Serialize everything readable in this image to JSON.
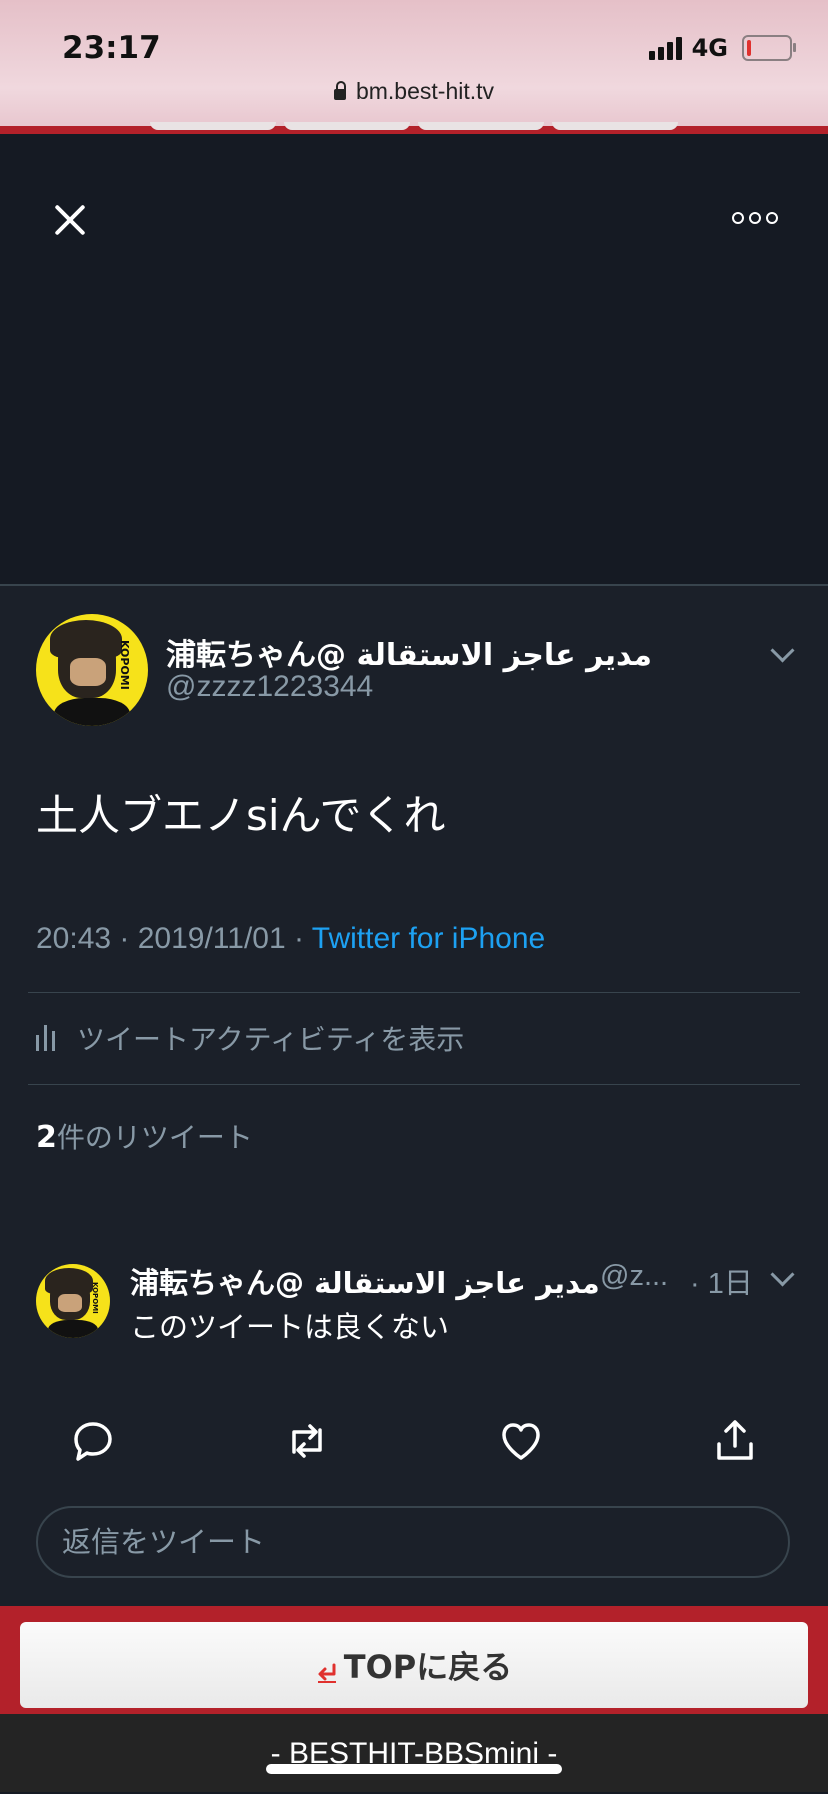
{
  "status_bar": {
    "time": "23:17",
    "network": "4G"
  },
  "browser": {
    "url": "bm.best-hit.tv"
  },
  "tweet": {
    "author_name": "浦転ちゃん@ مدير عاجز الاستقالة",
    "author_handle": "@zzzz1223344",
    "text": "土人ブエノsiんでくれ",
    "timestamp": "20:43 · 2019/11/01 · ",
    "source": "Twitter for iPhone",
    "activity_label": "ツイートアクティビティを表示",
    "retweet_count": "2",
    "retweet_label": "件のリツイート"
  },
  "reply": {
    "author_name": "浦転ちゃん@ مدير عاجز الاستقالة",
    "author_handle": "@z...",
    "time": "· 1日",
    "text": "このツイートは良くない"
  },
  "reply_input": {
    "placeholder": "返信をツイート"
  },
  "page": {
    "top_button_label": "TOPに戻る",
    "footer_prefix": "- ",
    "footer_link": "BESTHIT-BBSmini",
    "footer_suffix": " -"
  },
  "icons": {
    "close": "close-icon",
    "more": "more-icon",
    "chevron": "chevron-down-icon",
    "activity": "bar-chart-icon",
    "reply": "reply-icon",
    "retweet": "retweet-icon",
    "like": "heart-icon",
    "share": "share-icon",
    "return": "return-icon",
    "lock": "lock-icon"
  },
  "colors": {
    "background": "#151a23",
    "tweet_bg": "#1b2029",
    "link": "#1da1f2",
    "muted": "#8899a6",
    "page_accent": "#b3212a",
    "avatar_bg": "#f6e21a"
  }
}
